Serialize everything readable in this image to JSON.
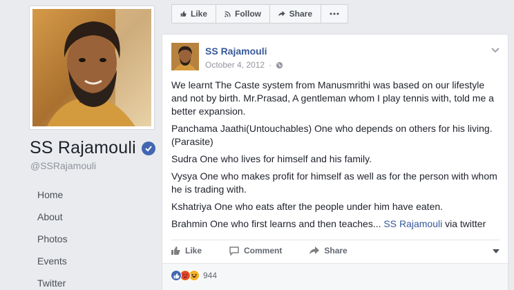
{
  "profile": {
    "name": "SS Rajamouli",
    "handle": "@SSRajamouli",
    "verified": true
  },
  "left_nav": [
    {
      "label": "Home"
    },
    {
      "label": "About"
    },
    {
      "label": "Photos"
    },
    {
      "label": "Events"
    },
    {
      "label": "Twitter"
    }
  ],
  "action_bar": {
    "like": "Like",
    "follow": "Follow",
    "share": "Share",
    "more_icon": "ellipsis-icon"
  },
  "post": {
    "author": "SS Rajamouli",
    "date": "October 4, 2012",
    "privacy_icon": "globe-icon",
    "paragraphs": [
      "We learnt The Caste system from Manusmrithi was based on our lifestyle and not by birth. Mr.Prasad, A gentleman whom I play tennis with, told me a better expansion.",
      "Panchama Jaathi(Untouchables) One who depends on others for his living.(Parasite)",
      "Sudra One who lives for himself and his family.",
      "Vysya One who makes profit for himself as well as for the person with whom he is trading with.",
      "Kshatriya One who eats after the people under him have eaten."
    ],
    "last_paragraph": {
      "text": "Brahmin One who first learns and then teaches... ",
      "link": "SS Rajamouli",
      "suffix": " via twitter"
    },
    "actions": {
      "like": "Like",
      "comment": "Comment",
      "share": "Share"
    },
    "reactions": {
      "types": [
        "like",
        "angry",
        "haha"
      ],
      "count": "944"
    }
  },
  "colors": {
    "brand_blue": "#4267b2",
    "link_blue": "#365899",
    "page_bg": "#e9ebee"
  }
}
